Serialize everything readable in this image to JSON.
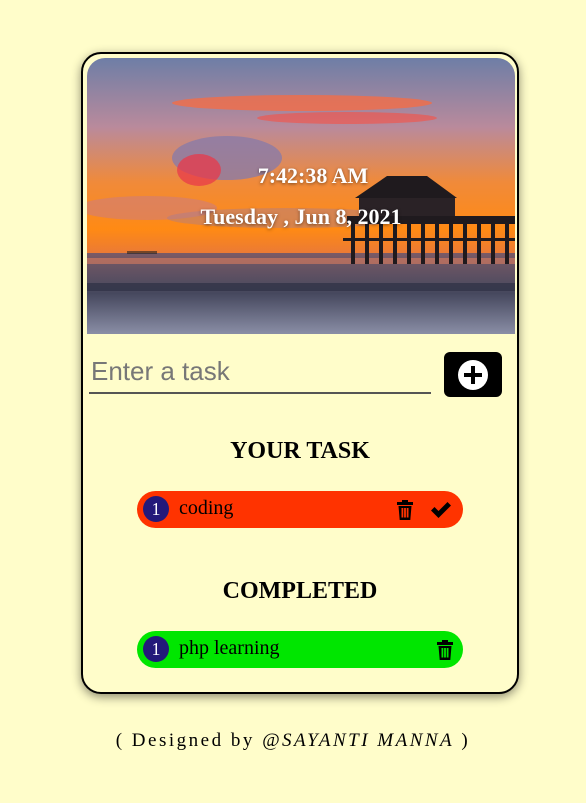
{
  "clock": {
    "time": "7:42:38 AM",
    "date": "Tuesday , Jun 8, 2021"
  },
  "task_input": {
    "placeholder": "Enter a task",
    "value": ""
  },
  "add_button": {
    "icon": "plus-circle-icon"
  },
  "your_task": {
    "title": "YOUR TASK",
    "items": [
      {
        "number": "1",
        "text": "coding",
        "icons": [
          "trash-icon",
          "check-icon"
        ]
      }
    ]
  },
  "completed": {
    "title": "COMPLETED",
    "items": [
      {
        "number": "1",
        "text": "php learning",
        "icons": [
          "trash-icon"
        ]
      }
    ]
  },
  "footer": {
    "prefix": "( Designed by ",
    "author": "@SAYANTI MANNA",
    "suffix": " )"
  },
  "colors": {
    "page_background": "#fffdca",
    "pending_task": "#ff3300",
    "completed_task": "#00e600",
    "task_number_badge": "#23197a",
    "add_button": "#000000"
  }
}
